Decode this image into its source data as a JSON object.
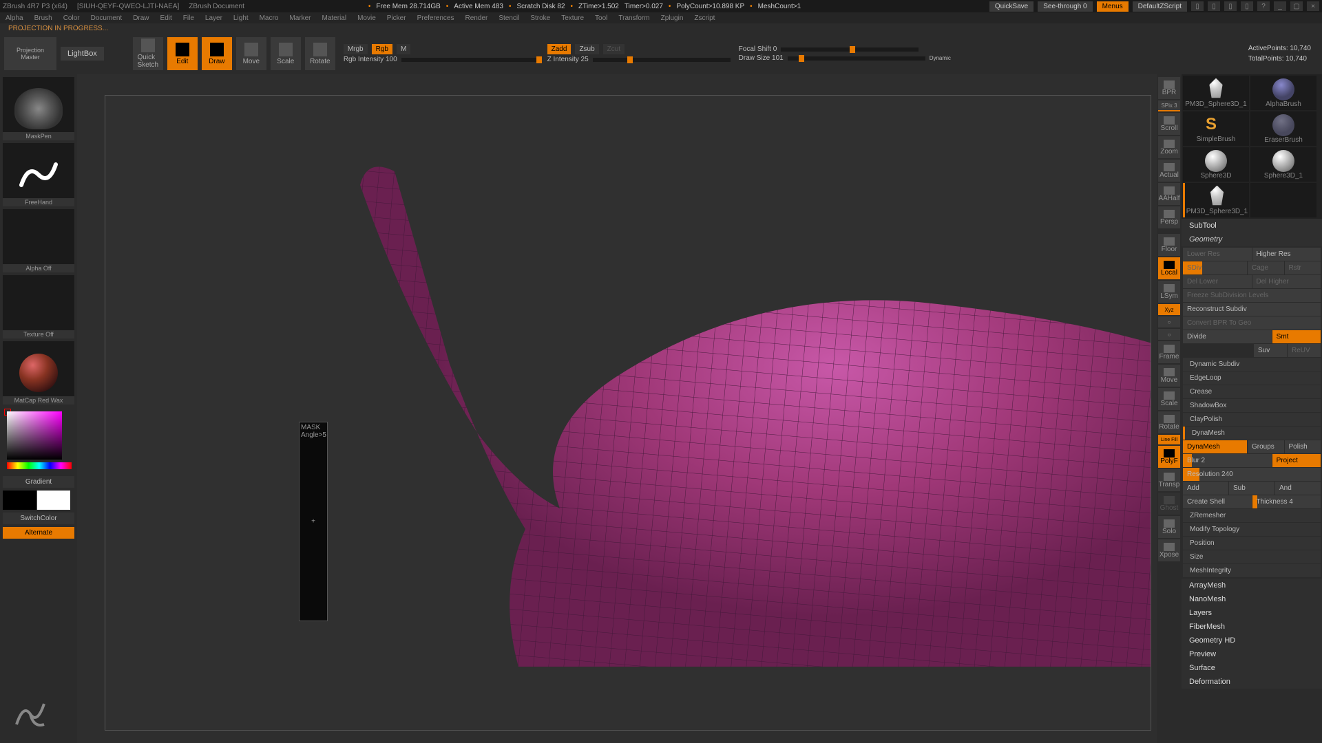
{
  "titlebar": {
    "app": "ZBrush 4R7 P3 (x64)",
    "doc": "[SIUH-QEYF-QWEO-LJTI-NAEA]",
    "title": "ZBrush Document",
    "mem": "Free Mem 28.714GB",
    "active": "Active Mem 483",
    "scratch": "Scratch Disk 82",
    "ztime": "ZTime>1.502",
    "timer": "Timer>0.027",
    "poly": "PolyCount>10.898 KP",
    "meshcount": "MeshCount>1",
    "quicksave": "QuickSave",
    "seethrough": "See-through   0",
    "menus": "Menus",
    "script": "DefaultZScript"
  },
  "menus": [
    "Alpha",
    "Brush",
    "Color",
    "Document",
    "Draw",
    "Edit",
    "File",
    "Layer",
    "Light",
    "Macro",
    "Marker",
    "Material",
    "Movie",
    "Picker",
    "Preferences",
    "Render",
    "Stencil",
    "Stroke",
    "Texture",
    "Tool",
    "Transform",
    "Zplugin",
    "Zscript"
  ],
  "status": "PROJECTION IN PROGRESS...",
  "tools": {
    "projection": "Projection\nMaster",
    "lightbox": "LightBox",
    "quicksketch": "Quick\nSketch",
    "edit": "Edit",
    "draw": "Draw",
    "move": "Move",
    "scale": "Scale",
    "rotate": "Rotate"
  },
  "sliders": {
    "mrgb": "Mrgb",
    "rgb": "Rgb",
    "m": "M",
    "rgb_intensity": "Rgb Intensity 100",
    "zadd": "Zadd",
    "zsub": "Zsub",
    "zcut": "Zcut",
    "z_intensity": "Z Intensity 25",
    "focal": "Focal Shift 0",
    "draw_size": "Draw Size 101",
    "dynamic": "Dynamic"
  },
  "stats": {
    "active": "ActivePoints: 10,740",
    "total": "TotalPoints: 10,740"
  },
  "left": {
    "brush": "MaskPen",
    "stroke": "FreeHand",
    "alpha": "Alpha Off",
    "texture": "Texture Off",
    "material": "MatCap Red Wax",
    "gradient": "Gradient",
    "switchcolor": "SwitchColor",
    "alternate": "Alternate"
  },
  "popup": {
    "l1": "MASK",
    "l2": "Angle>5"
  },
  "rshelf": {
    "bpr": "BPR",
    "spix": "SPix 3",
    "scroll": "Scroll",
    "zoom": "Zoom",
    "actual": "Actual",
    "aahalf": "AAHalf",
    "persp": "Persp",
    "floor": "Floor",
    "local": "Local",
    "lsym": "LSym",
    "xyz": "Xyz",
    "frame": "Frame",
    "move": "Move",
    "scale": "Scale",
    "rotate": "Rotate",
    "polyf": "PolyF",
    "transp": "Transp",
    "ghost": "Ghost",
    "solo": "Solo",
    "xpose": "Xpose"
  },
  "tray": {
    "t1": "PM3D_Sphere3D_1",
    "t2": "AlphaBrush",
    "t3": "SimpleBrush",
    "t4": "EraserBrush",
    "t5": "Sphere3D",
    "t6": "Sphere3D_1",
    "t7": "PM3D_Sphere3D_1"
  },
  "panel": {
    "subtool": "SubTool",
    "geometry": "Geometry",
    "lower": "Lower Res",
    "higher": "Higher Res",
    "sdiv": "SDiv",
    "cage": "Cage",
    "rstr": "Rstr",
    "del_lower": "Del Lower",
    "del_higher": "Del Higher",
    "freeze": "Freeze SubDivision Levels",
    "reconstruct": "Reconstruct Subdiv",
    "convert": "Convert BPR To Geo",
    "divide": "Divide",
    "smt": "Smt",
    "suv": "Suv",
    "rediv": "ReUV",
    "dynsub": "Dynamic Subdiv",
    "edgeloop": "EdgeLoop",
    "crease": "Crease",
    "shadowbox": "ShadowBox",
    "claypolish": "ClayPolish",
    "dynamesh": "DynaMesh",
    "dyn_btn": "DynaMesh",
    "groups": "Groups",
    "polish": "Polish",
    "blur": "Blur 2",
    "project": "Project",
    "resolution": "Resolution 240",
    "add": "Add",
    "sub": "Sub",
    "and": "And",
    "createshell": "Create Shell",
    "thickness": "Thickness 4",
    "zremesher": "ZRemesher",
    "modtopo": "Modify Topology",
    "position": "Position",
    "size": "Size",
    "meshint": "MeshIntegrity",
    "arraymesh": "ArrayMesh",
    "nanomesh": "NanoMesh",
    "layers": "Layers",
    "fibermesh": "FiberMesh",
    "geohd": "Geometry HD",
    "preview": "Preview",
    "surface": "Surface",
    "deformation": "Deformation"
  }
}
